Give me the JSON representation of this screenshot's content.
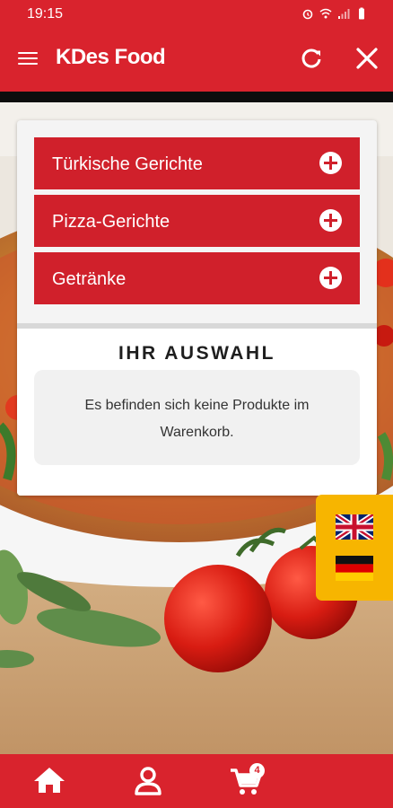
{
  "status_bar": {
    "time": "19:15"
  },
  "app_bar": {
    "title": "KDes Food"
  },
  "categories": [
    {
      "label": "Türkische Gerichte",
      "icon": "plus-circle-icon"
    },
    {
      "label": "Pizza-Gerichte",
      "icon": "plus-circle-icon"
    },
    {
      "label": "Getränke",
      "icon": "plus-circle-icon"
    }
  ],
  "selection": {
    "title": "IHR AUSWAHL",
    "empty_message": "Es befinden sich keine Produkte im Warenkorb."
  },
  "languages": [
    {
      "flag": "uk-flag-icon"
    },
    {
      "flag": "germany-flag-icon"
    }
  ],
  "bottom_nav": {
    "items": [
      "home-icon",
      "user-icon",
      "cart-icon"
    ],
    "cart_count": "4"
  },
  "colors": {
    "primary": "#d9232d",
    "button": "#d0202b",
    "accent": "#f7b500"
  }
}
